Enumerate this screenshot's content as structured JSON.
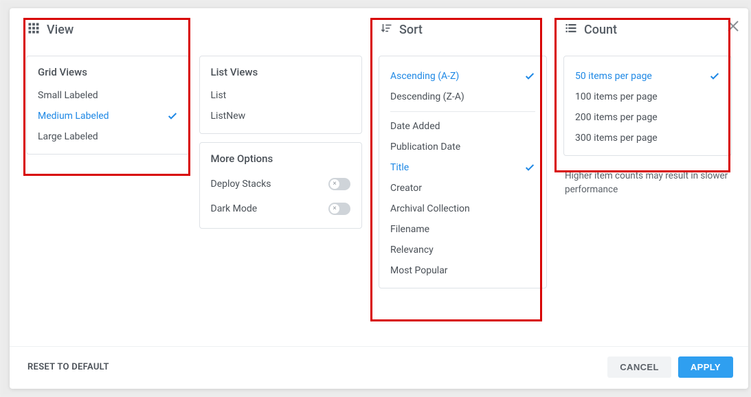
{
  "view": {
    "header": "View",
    "grid": {
      "title": "Grid Views",
      "small": "Small Labeled",
      "medium": "Medium Labeled",
      "large": "Large Labeled"
    },
    "list": {
      "title": "List Views",
      "list": "List",
      "listnew": "ListNew"
    },
    "more": {
      "title": "More Options",
      "deploy": "Deploy Stacks",
      "dark": "Dark Mode"
    }
  },
  "sort": {
    "header": "Sort",
    "asc": "Ascending (A-Z)",
    "desc": "Descending (Z-A)",
    "date_added": "Date Added",
    "pub_date": "Publication Date",
    "title": "Title",
    "creator": "Creator",
    "archival": "Archival Collection",
    "filename": "Filename",
    "relevancy": "Relevancy",
    "popular": "Most Popular"
  },
  "count": {
    "header": "Count",
    "c50": "50 items per page",
    "c100": "100 items per page",
    "c200": "200 items per page",
    "c300": "300 items per page",
    "hint": "Higher item counts may result in slower performance"
  },
  "footer": {
    "reset": "RESET TO DEFAULT",
    "cancel": "CANCEL",
    "apply": "APPLY"
  }
}
